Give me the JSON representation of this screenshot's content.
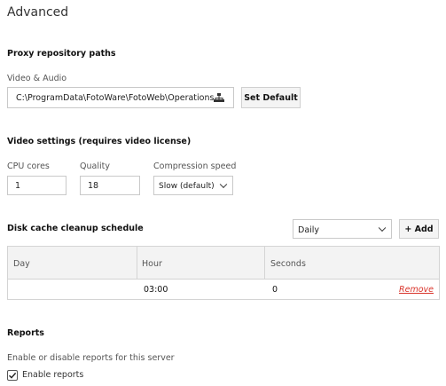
{
  "page": {
    "title": "Advanced"
  },
  "proxy": {
    "heading": "Proxy repository paths",
    "field_label": "Video & Audio",
    "path_value": "C:\\ProgramData\\FotoWare\\FotoWeb\\Operations",
    "browse_icon": "sitemap-icon",
    "set_default_label": "Set Default"
  },
  "video": {
    "heading": "Video settings (requires video license)",
    "cpu_label": "CPU cores",
    "cpu_value": "1",
    "quality_label": "Quality",
    "quality_value": "18",
    "compression_label": "Compression speed",
    "compression_value": "Slow (default)"
  },
  "cleanup": {
    "heading": "Disk cache cleanup schedule",
    "frequency_value": "Daily",
    "add_label": "+ Add",
    "columns": [
      "Day",
      "Hour",
      "Seconds"
    ],
    "rows": [
      {
        "day": "",
        "hour": "03:00",
        "seconds": "0",
        "action": "Remove"
      }
    ]
  },
  "reports": {
    "heading": "Reports",
    "description": "Enable or disable reports for this server",
    "checkbox_label": "Enable reports",
    "enabled": true
  },
  "colors": {
    "accent_remove": "#d9342b",
    "border": "#c9c9c9",
    "header_bg": "#f3f3f3"
  }
}
